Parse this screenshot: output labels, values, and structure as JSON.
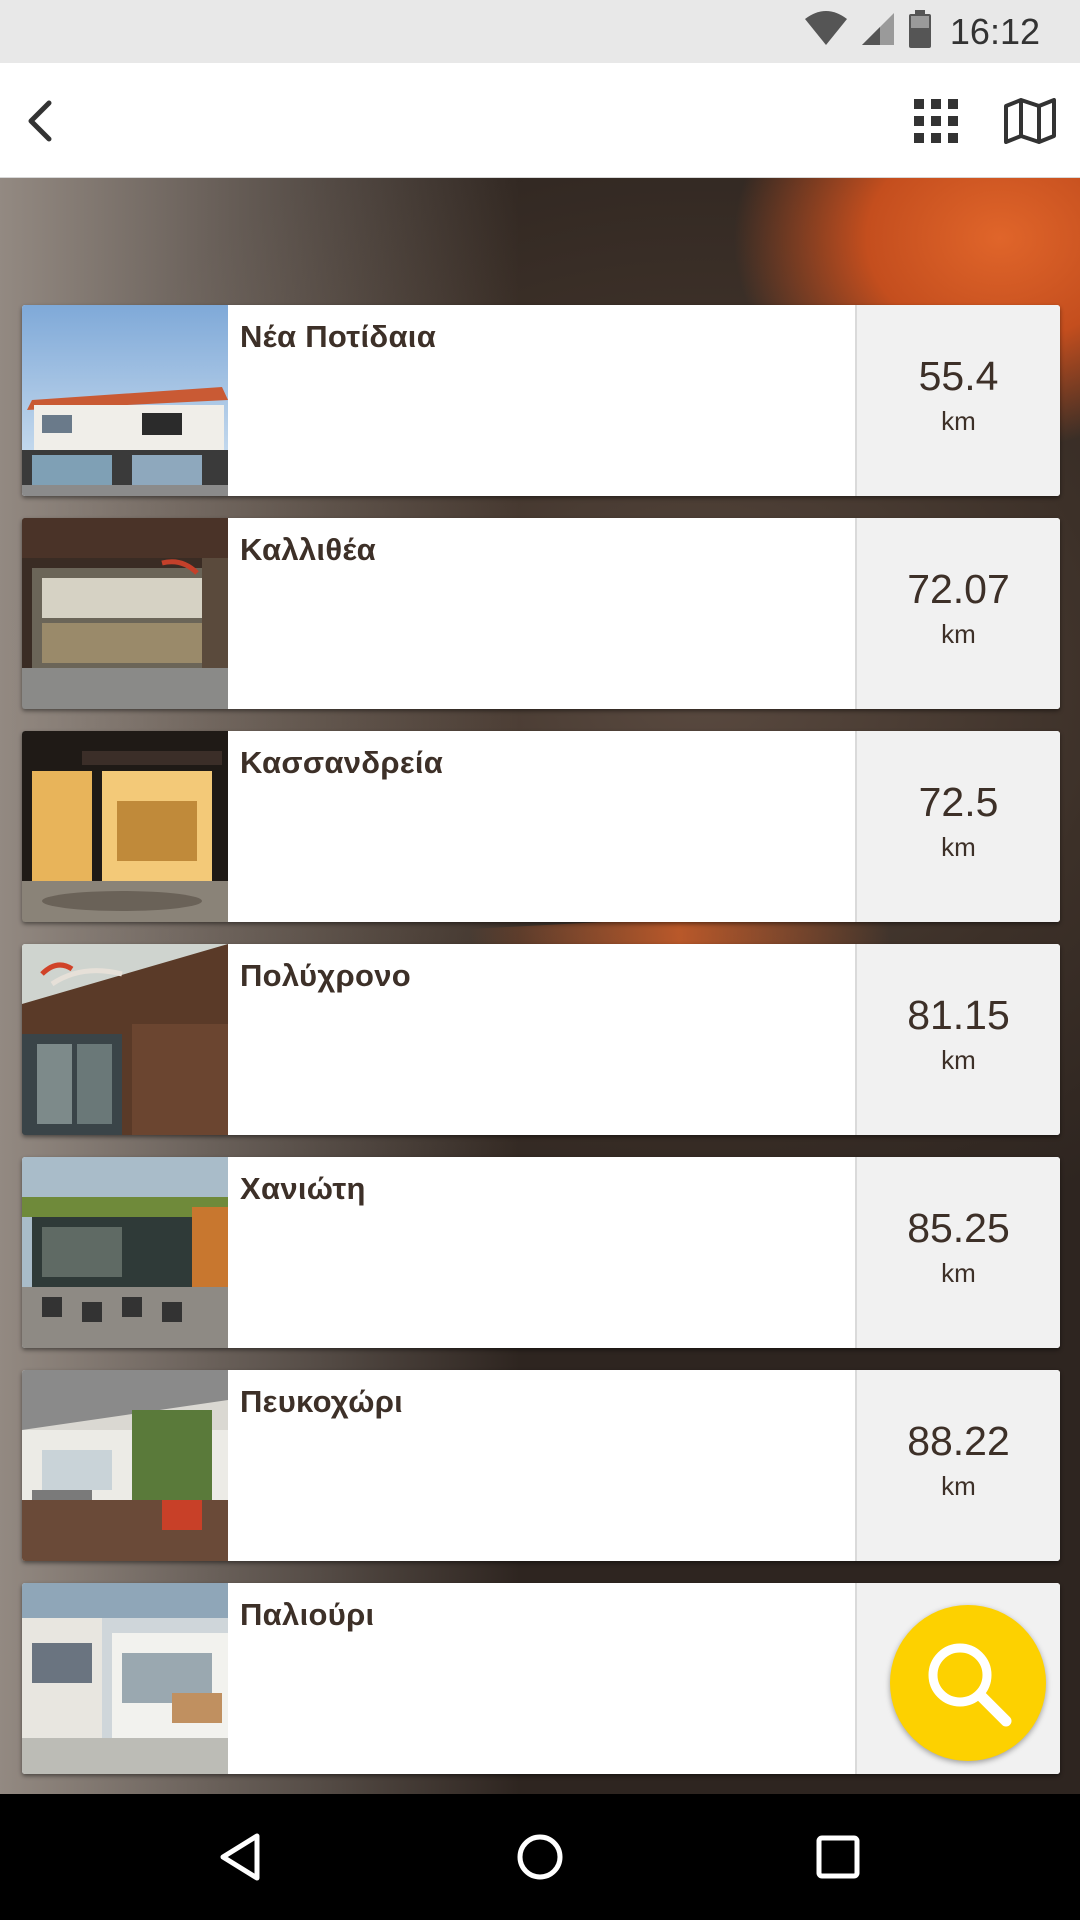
{
  "status_bar": {
    "time": "16:12",
    "icons": [
      "wifi-icon",
      "cell-signal-icon",
      "battery-icon"
    ]
  },
  "app_bar": {
    "icons": [
      "back-arrow-icon",
      "grid-icon",
      "map-icon"
    ]
  },
  "stores": [
    {
      "name": "Νέα Ποτίδαια",
      "distance": "55.4",
      "unit": "km"
    },
    {
      "name": "Καλλιθέα",
      "distance": "72.07",
      "unit": "km"
    },
    {
      "name": "Κασσανδρεία",
      "distance": "72.5",
      "unit": "km"
    },
    {
      "name": "Πολύχρονο",
      "distance": "81.15",
      "unit": "km"
    },
    {
      "name": "Χανιώτη",
      "distance": "85.25",
      "unit": "km"
    },
    {
      "name": "Πευκοχώρι",
      "distance": "88.22",
      "unit": "km"
    },
    {
      "name": "Παλιούρι",
      "distance": "",
      "unit": ""
    }
  ],
  "fab": {
    "icon": "search-icon",
    "color": "#fdd100"
  },
  "nav_bar": {
    "icons": [
      "back-triangle-icon",
      "home-circle-icon",
      "recents-square-icon"
    ]
  },
  "colors": {
    "text": "#3d3028",
    "distance_bg": "#f1f1f1",
    "accent": "#fdd100"
  }
}
